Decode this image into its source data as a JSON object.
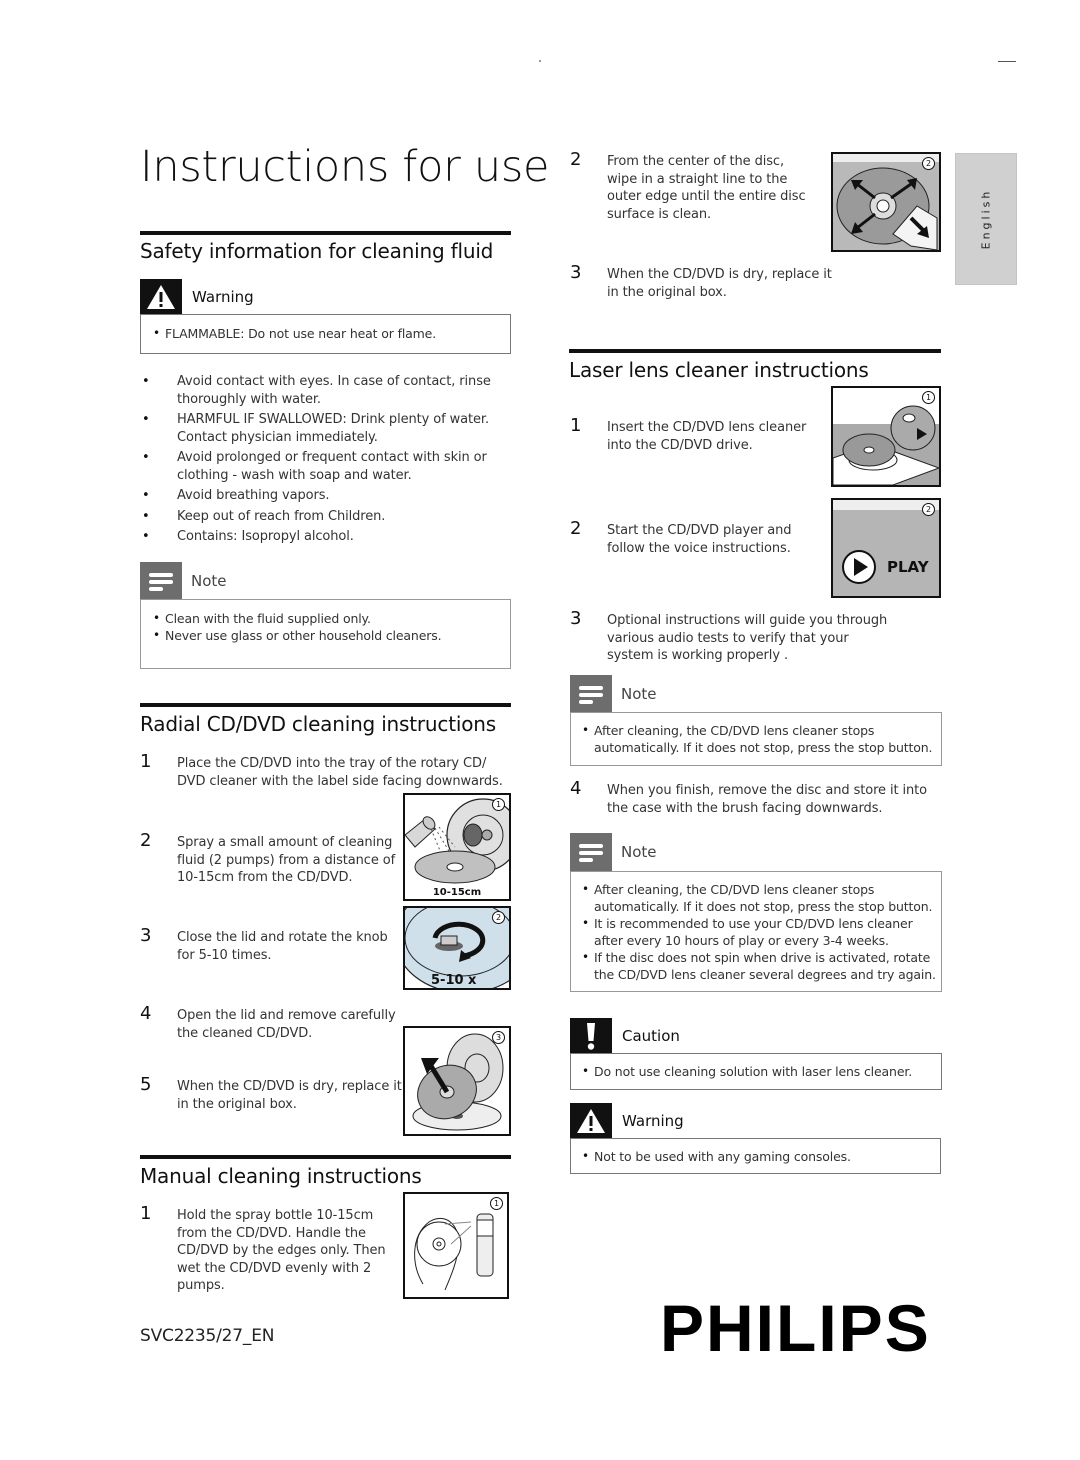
{
  "page": {
    "title": "Instructions for use",
    "language_tab": "English",
    "model_code": "SVC2235/27_EN",
    "brand": "PHILIPS"
  },
  "safety": {
    "heading": "Safety information for cleaning fluid",
    "warning": {
      "label": "Warning",
      "icon": "warning-triangle-icon",
      "items": [
        "FLAMMABLE: Do not use near heat or flame."
      ]
    },
    "bullets": [
      "Avoid contact with eyes. In case of contact, rinse thoroughly with water.",
      "HARMFUL IF SWALLOWED: Drink plenty of water. Contact physician immediately.",
      "Avoid prolonged or frequent contact with skin or clothing - wash with soap and water.",
      "Avoid breathing vapors.",
      "Keep out of reach from Children.",
      "Contains: Isopropyl alcohol."
    ],
    "note": {
      "label": "Note",
      "icon": "note-icon",
      "items": [
        "Clean with the fluid supplied only.",
        "Never use glass or other household cleaners."
      ]
    }
  },
  "radial": {
    "heading": "Radial CD/DVD cleaning instructions",
    "steps": [
      {
        "num": "1",
        "text": "Place the CD/DVD into the tray of the rotary CD/ DVD cleaner with the label side facing downwards."
      },
      {
        "num": "2",
        "text": "Spray a small amount of cleaning fluid (2 pumps) from a distance of 10-15cm from the CD/DVD."
      },
      {
        "num": "3",
        "text": "Close the lid and rotate the knob for 5-10 times."
      },
      {
        "num": "4",
        "text": "Open the lid and remove carefully the cleaned CD/DVD."
      },
      {
        "num": "5",
        "text": "When the CD/DVD is dry, replace it in the original box."
      }
    ],
    "figures": [
      {
        "num": "1",
        "caption": "10-15cm"
      },
      {
        "num": "2",
        "caption": "5-10 x"
      },
      {
        "num": "3",
        "caption": ""
      }
    ]
  },
  "manual": {
    "heading": "Manual cleaning instructions",
    "steps": [
      {
        "num": "1",
        "text": "Hold the spray bottle 10-15cm from the CD/DVD. Handle the CD/DVD by the edges only. Then wet the CD/DVD evenly with 2 pumps."
      },
      {
        "num": "2",
        "text": "From the center of the disc, wipe in a straight line to the outer edge until the entire disc surface is clean."
      },
      {
        "num": "3",
        "text": "When the CD/DVD is dry, replace it in the original box."
      }
    ],
    "figures": [
      {
        "num": "1"
      },
      {
        "num": "2"
      }
    ]
  },
  "laser": {
    "heading": "Laser lens cleaner instructions",
    "steps": [
      {
        "num": "1",
        "text": "Insert the CD/DVD lens cleaner into the CD/DVD drive."
      },
      {
        "num": "2",
        "text": "Start the CD/DVD player and follow the voice instructions."
      },
      {
        "num": "3",
        "text": "Optional instructions will guide you through various audio tests to verify that your system is working properly ."
      },
      {
        "num": "4",
        "text": "When you finish, remove the disc and store it into the case with the brush facing downwards."
      }
    ],
    "figures": [
      {
        "num": "1"
      },
      {
        "num": "2",
        "caption": "PLAY"
      }
    ],
    "note1": {
      "label": "Note",
      "items": [
        "After cleaning, the CD/DVD lens cleaner stops automatically. If it does not stop, press the stop button."
      ]
    },
    "note2": {
      "label": "Note",
      "items": [
        "After cleaning, the CD/DVD lens cleaner stops automatically. If it does not stop, press the stop button.",
        " It is recommended to use your CD/DVD lens cleaner after every 10 hours of play or every 3-4 weeks.",
        "If the disc does not spin when drive is activated, rotate the CD/DVD lens cleaner several degrees and try again."
      ]
    },
    "caution": {
      "label": "Caution",
      "icon": "exclamation-icon",
      "items": [
        "Do not use cleaning solution with laser lens cleaner."
      ]
    },
    "warning": {
      "label": "Warning",
      "icon": "warning-triangle-icon",
      "items": [
        "Not to be used with any gaming consoles."
      ]
    }
  }
}
